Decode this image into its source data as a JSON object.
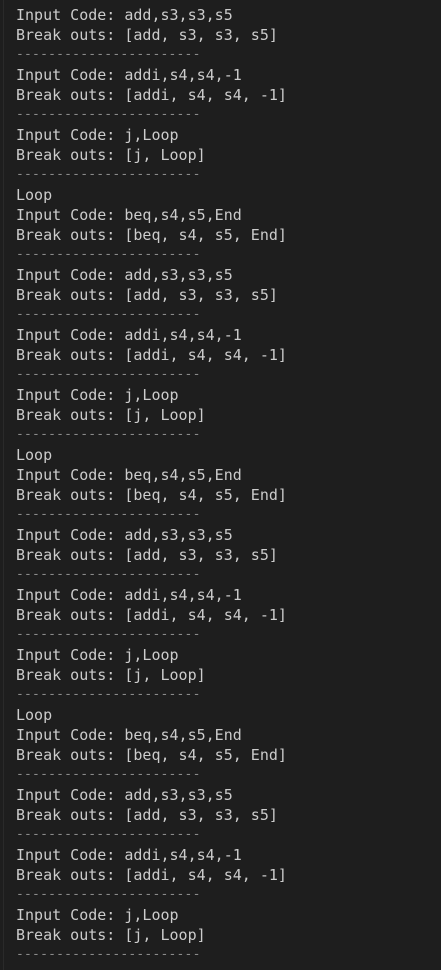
{
  "terminal": {
    "lines": [
      {
        "kind": "text",
        "text": "Input Code: add,s3,s3,s5"
      },
      {
        "kind": "text",
        "text": "Break outs: [add, s3, s3, s5]"
      },
      {
        "kind": "sep",
        "text": "-----------------------"
      },
      {
        "kind": "text",
        "text": "Input Code: addi,s4,s4,-1"
      },
      {
        "kind": "text",
        "text": "Break outs: [addi, s4, s4, -1]"
      },
      {
        "kind": "sep",
        "text": "-----------------------"
      },
      {
        "kind": "text",
        "text": "Input Code: j,Loop"
      },
      {
        "kind": "text",
        "text": "Break outs: [j, Loop]"
      },
      {
        "kind": "sep",
        "text": "-----------------------"
      },
      {
        "kind": "text",
        "text": "Loop"
      },
      {
        "kind": "text",
        "text": "Input Code: beq,s4,s5,End"
      },
      {
        "kind": "text",
        "text": "Break outs: [beq, s4, s5, End]"
      },
      {
        "kind": "sep",
        "text": "-----------------------"
      },
      {
        "kind": "text",
        "text": "Input Code: add,s3,s3,s5"
      },
      {
        "kind": "text",
        "text": "Break outs: [add, s3, s3, s5]"
      },
      {
        "kind": "sep",
        "text": "-----------------------"
      },
      {
        "kind": "text",
        "text": "Input Code: addi,s4,s4,-1"
      },
      {
        "kind": "text",
        "text": "Break outs: [addi, s4, s4, -1]"
      },
      {
        "kind": "sep",
        "text": "-----------------------"
      },
      {
        "kind": "text",
        "text": "Input Code: j,Loop"
      },
      {
        "kind": "text",
        "text": "Break outs: [j, Loop]"
      },
      {
        "kind": "sep",
        "text": "-----------------------"
      },
      {
        "kind": "text",
        "text": "Loop"
      },
      {
        "kind": "text",
        "text": "Input Code: beq,s4,s5,End"
      },
      {
        "kind": "text",
        "text": "Break outs: [beq, s4, s5, End]"
      },
      {
        "kind": "sep",
        "text": "-----------------------"
      },
      {
        "kind": "text",
        "text": "Input Code: add,s3,s3,s5"
      },
      {
        "kind": "text",
        "text": "Break outs: [add, s3, s3, s5]"
      },
      {
        "kind": "sep",
        "text": "-----------------------"
      },
      {
        "kind": "text",
        "text": "Input Code: addi,s4,s4,-1"
      },
      {
        "kind": "text",
        "text": "Break outs: [addi, s4, s4, -1]"
      },
      {
        "kind": "sep",
        "text": "-----------------------"
      },
      {
        "kind": "text",
        "text": "Input Code: j,Loop"
      },
      {
        "kind": "text",
        "text": "Break outs: [j, Loop]"
      },
      {
        "kind": "sep",
        "text": "-----------------------"
      },
      {
        "kind": "text",
        "text": "Loop"
      },
      {
        "kind": "text",
        "text": "Input Code: beq,s4,s5,End"
      },
      {
        "kind": "text",
        "text": "Break outs: [beq, s4, s5, End]"
      },
      {
        "kind": "sep",
        "text": "-----------------------"
      },
      {
        "kind": "text",
        "text": "Input Code: add,s3,s3,s5"
      },
      {
        "kind": "text",
        "text": "Break outs: [add, s3, s3, s5]"
      },
      {
        "kind": "sep",
        "text": "-----------------------"
      },
      {
        "kind": "text",
        "text": "Input Code: addi,s4,s4,-1"
      },
      {
        "kind": "text",
        "text": "Break outs: [addi, s4, s4, -1]"
      },
      {
        "kind": "sep",
        "text": "-----------------------"
      },
      {
        "kind": "text",
        "text": "Input Code: j,Loop"
      },
      {
        "kind": "text",
        "text": "Break outs: [j, Loop]"
      },
      {
        "kind": "sep",
        "text": "-----------------------"
      }
    ],
    "colors": {
      "background": "#1e1e1e",
      "text": "#cccccc",
      "separator": "#8a8a8a"
    }
  }
}
